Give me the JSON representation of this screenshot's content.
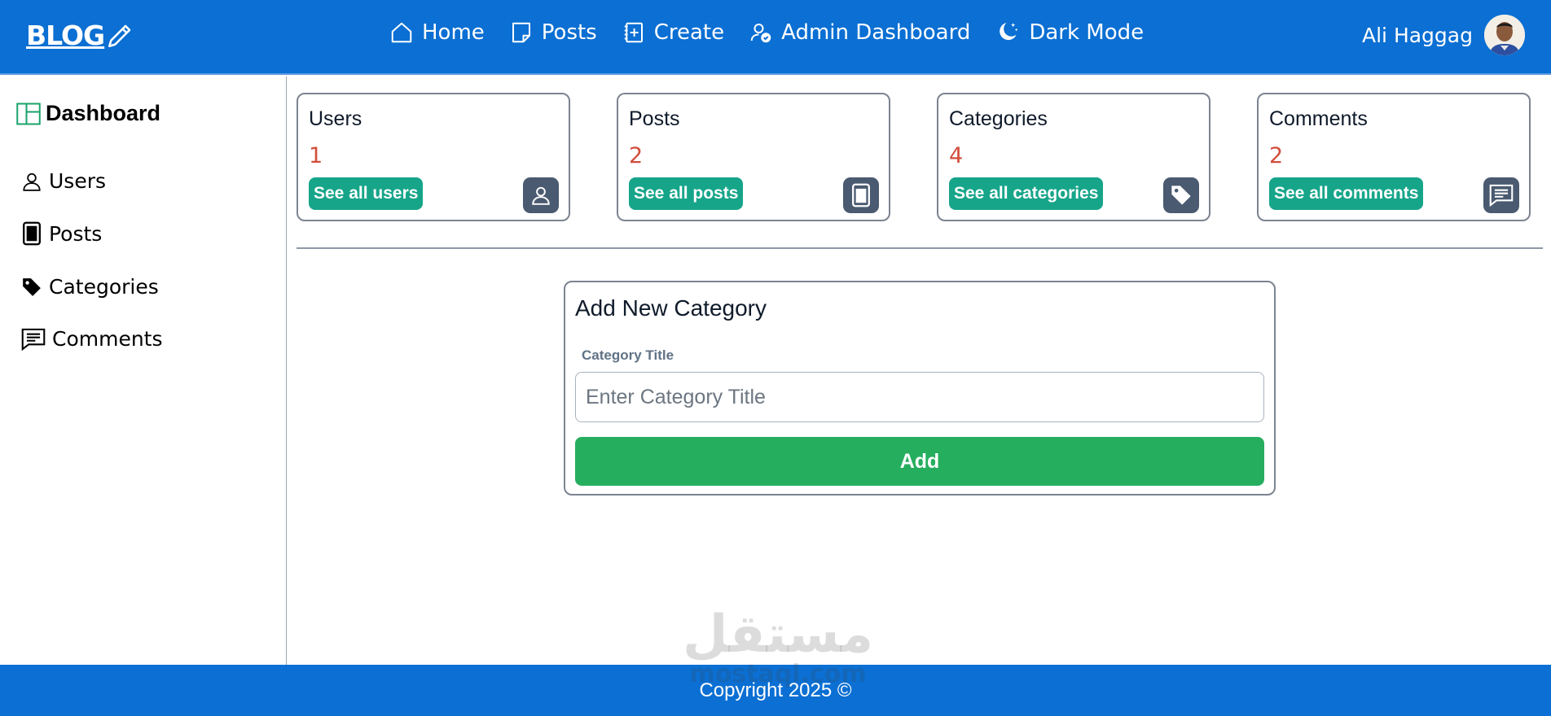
{
  "header": {
    "logo_text": "BLOG",
    "nav": [
      {
        "label": "Home"
      },
      {
        "label": "Posts"
      },
      {
        "label": "Create"
      },
      {
        "label": "Admin Dashboard"
      },
      {
        "label": "Dark Mode"
      }
    ],
    "user_name": "Ali Haggag"
  },
  "sidebar": {
    "title": "Dashboard",
    "items": [
      {
        "label": "Users"
      },
      {
        "label": "Posts"
      },
      {
        "label": "Categories"
      },
      {
        "label": "Comments"
      }
    ]
  },
  "cards": [
    {
      "title": "Users",
      "count": "1",
      "button": "See all users",
      "icon": "user-icon"
    },
    {
      "title": "Posts",
      "count": "2",
      "button": "See all posts",
      "icon": "post-icon"
    },
    {
      "title": "Categories",
      "count": "4",
      "button": "See all categories",
      "icon": "tag-icon"
    },
    {
      "title": "Comments",
      "count": "2",
      "button": "See all comments",
      "icon": "comment-icon"
    }
  ],
  "form": {
    "title": "Add New Category",
    "label": "Category Title",
    "placeholder": "Enter Category Title",
    "value": "",
    "button": "Add"
  },
  "footer": {
    "text": "Copyright 2025 ©"
  },
  "watermark": {
    "arabic": "مستقل",
    "latin": "mostaql.com"
  },
  "colors": {
    "header_bg": "#0b6fd3",
    "card_button": "#17a58a",
    "count_color": "#d24d3b",
    "add_button": "#26ae5f",
    "icon_bg": "#4a5a70"
  }
}
